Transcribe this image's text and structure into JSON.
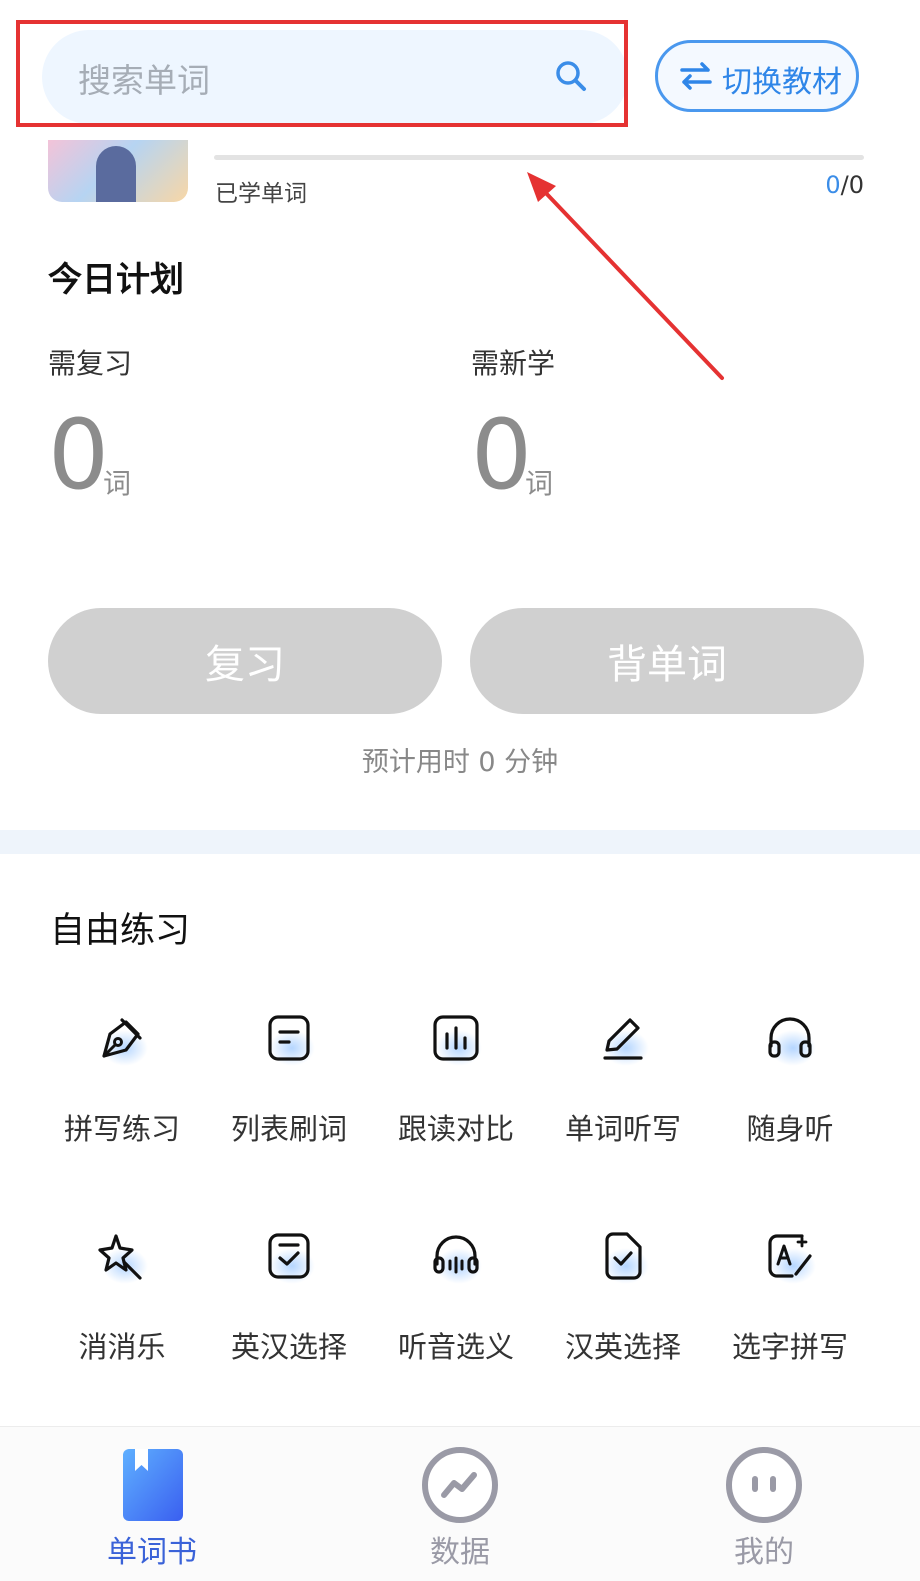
{
  "search": {
    "placeholder": "搜索单词"
  },
  "switch_button": {
    "label": "切换教材"
  },
  "book": {
    "learned_label": "已学单词",
    "learned_current": "0",
    "learned_total": "/0"
  },
  "plan": {
    "title": "今日计划",
    "review": {
      "label": "需复习",
      "count": "0",
      "unit": "词"
    },
    "new": {
      "label": "需新学",
      "count": "0",
      "unit": "词"
    },
    "review_button": "复习",
    "learn_button": "背单词",
    "estimate": "预计用时 0 分钟"
  },
  "practice": {
    "title": "自由练习",
    "items": [
      {
        "label": "拼写练习",
        "icon": "pen-nib-icon"
      },
      {
        "label": "列表刷词",
        "icon": "list-card-icon"
      },
      {
        "label": "跟读对比",
        "icon": "audio-bars-icon"
      },
      {
        "label": "单词听写",
        "icon": "pencil-icon"
      },
      {
        "label": "随身听",
        "icon": "headphones-icon"
      },
      {
        "label": "消消乐",
        "icon": "magic-star-icon"
      },
      {
        "label": "英汉选择",
        "icon": "check-card-icon"
      },
      {
        "label": "听音选义",
        "icon": "headset-wave-icon"
      },
      {
        "label": "汉英选择",
        "icon": "check-doc-icon"
      },
      {
        "label": "选字拼写",
        "icon": "letter-edit-icon"
      }
    ]
  },
  "nav": {
    "items": [
      {
        "label": "单词书",
        "active": true
      },
      {
        "label": "数据",
        "active": false
      },
      {
        "label": "我的",
        "active": false
      }
    ]
  },
  "colors": {
    "accent": "#3b8de8",
    "highlight": "#e53232",
    "disabled_button": "#d0d0d0"
  }
}
